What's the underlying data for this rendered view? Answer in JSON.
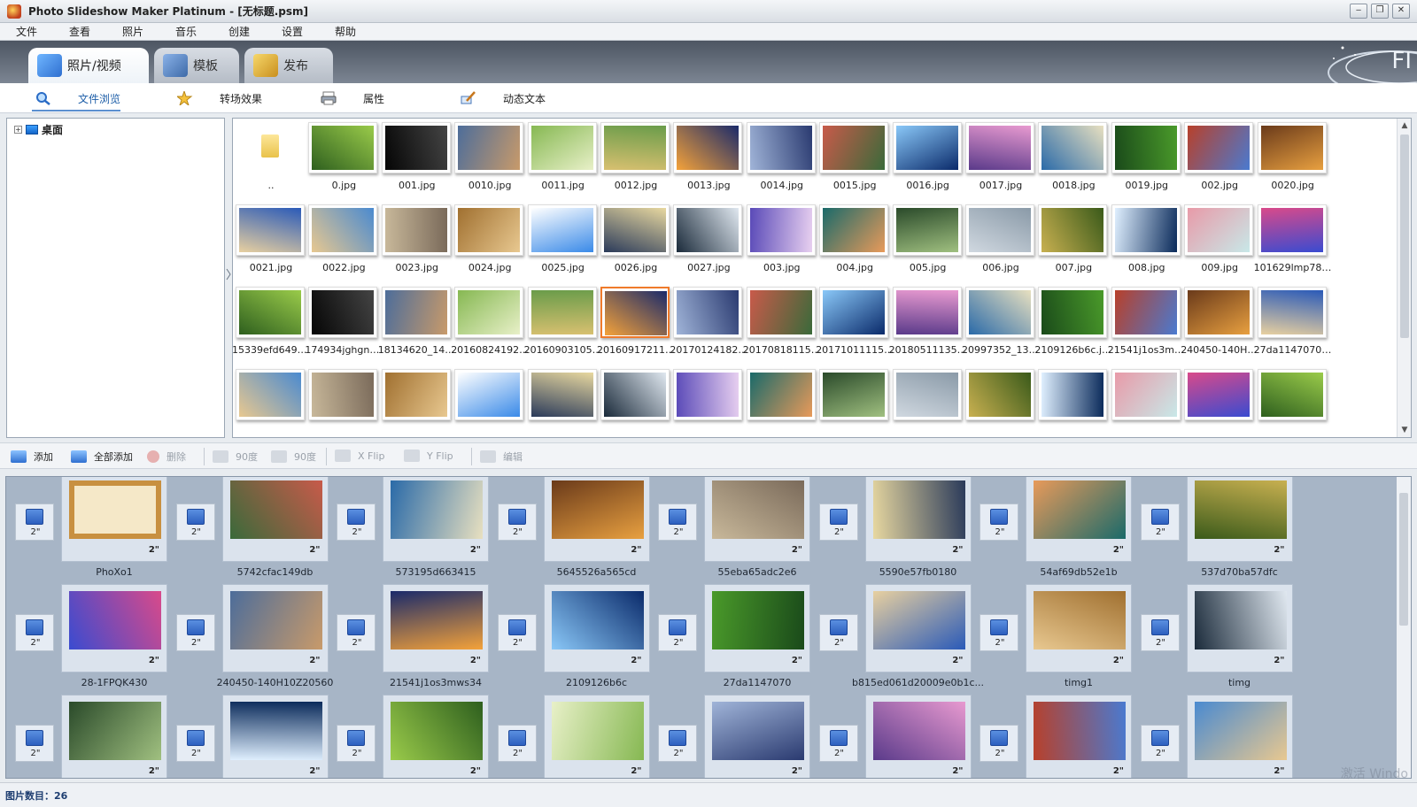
{
  "window": {
    "title": "Photo Slideshow Maker Platinum - [无标题.psm]",
    "minimize": "‒",
    "restore": "❐",
    "close": "✕"
  },
  "menu": [
    "文件",
    "查看",
    "照片",
    "音乐",
    "创建",
    "设置",
    "帮助"
  ],
  "tabs": [
    {
      "label": "照片/视频",
      "active": true,
      "icon": "photo-video-icon"
    },
    {
      "label": "模板",
      "active": false,
      "icon": "film-template-icon"
    },
    {
      "label": "发布",
      "active": false,
      "icon": "publish-icon"
    }
  ],
  "deco_text": "FI",
  "subtabs": [
    {
      "label": "文件浏览",
      "active": true,
      "icon": "magnifier-icon"
    },
    {
      "label": "转场效果",
      "active": false,
      "icon": "star-transition-icon"
    },
    {
      "label": "属性",
      "active": false,
      "icon": "printer-properties-icon"
    },
    {
      "label": "动态文本",
      "active": false,
      "icon": "text-pen-icon"
    }
  ],
  "tree": {
    "expand": "+",
    "label": "桌面"
  },
  "browser": {
    "files": [
      "..",
      "0.jpg",
      "001.jpg",
      "0010.jpg",
      "0011.jpg",
      "0012.jpg",
      "0013.jpg",
      "0014.jpg",
      "0015.jpg",
      "0016.jpg",
      "0017.jpg",
      "0018.jpg",
      "0019.jpg",
      "002.jpg",
      "0020.jpg",
      "0021.jpg",
      "0022.jpg",
      "0023.jpg",
      "0024.jpg",
      "0025.jpg",
      "0026.jpg",
      "0027.jpg",
      "003.jpg",
      "004.jpg",
      "005.jpg",
      "006.jpg",
      "007.jpg",
      "008.jpg",
      "009.jpg",
      "101629lmp78y...",
      "15339efd649fd...",
      "174934jghgnog...",
      "18134620_142...",
      "201608241920...",
      "201609031050...",
      "201609172119...",
      "201701241821...",
      "201708181153...",
      "201710111158...",
      "201805111356...",
      "20997352_136...",
      "2109126b6c.jpg",
      "21541j1os3mw...",
      "240450-140H1...",
      "27da1147070.jpg",
      "",
      "",
      "",
      "",
      "",
      "",
      "",
      "",
      "",
      "",
      "",
      "",
      "",
      "",
      ""
    ],
    "selected_index": 35
  },
  "toolbar": [
    {
      "label": "添加",
      "icon": "add-photo-icon",
      "enabled": true
    },
    {
      "label": "全部添加",
      "icon": "add-all-icon",
      "enabled": true
    },
    {
      "label": "删除",
      "icon": "delete-icon",
      "enabled": false
    },
    {
      "label": "90度",
      "icon": "rotate-left-icon",
      "enabled": false
    },
    {
      "label": "90度",
      "icon": "rotate-right-icon",
      "enabled": false
    },
    {
      "label": "X Flip",
      "icon": "flip-x-icon",
      "enabled": false
    },
    {
      "label": "Y Flip",
      "icon": "flip-y-icon",
      "enabled": false
    },
    {
      "label": "编辑",
      "icon": "edit-icon",
      "enabled": false
    }
  ],
  "storyboard": {
    "transition_duration": "2\"",
    "slide_duration": "2\"",
    "slides": [
      "PhoXo1",
      "5742cfac149db",
      "573195d663415",
      "5645526a565cd",
      "55eba65adc2e6",
      "5590e57fb0180",
      "54af69db52e1b",
      "537d70ba57dfc",
      "28-1FPQK430",
      "240450-140H10Z20560",
      "21541j1os3mws34",
      "2109126b6c",
      "27da1147070",
      "b815ed061d20009e0b1c...",
      "timg1",
      "timg",
      "",
      "",
      "",
      "",
      "",
      "",
      "",
      ""
    ]
  },
  "status": {
    "label": "图片数目：26"
  },
  "watermark": "激活 Windo"
}
